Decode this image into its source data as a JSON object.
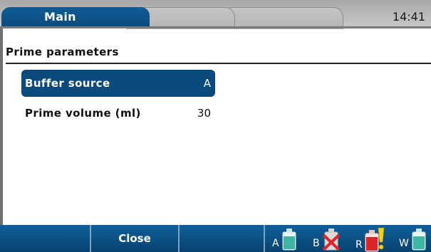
{
  "header": {
    "tabs": [
      {
        "label": "Main",
        "active": true
      },
      {
        "label": "",
        "active": false
      },
      {
        "label": "",
        "active": false
      }
    ],
    "clock": "14:41"
  },
  "section": {
    "title": "Prime parameters"
  },
  "parameters": [
    {
      "name": "Buffer source",
      "value": "A",
      "selected": true
    },
    {
      "name": "Prime volume (ml)",
      "value": "30",
      "selected": false
    }
  ],
  "footer": {
    "buttons": [
      "",
      "Close",
      ""
    ],
    "bottles": [
      {
        "letter": "A",
        "icon": "bottle-teal-icon",
        "status": "ok"
      },
      {
        "letter": "B",
        "icon": "bottle-empty-crossed-icon",
        "status": "not-available"
      },
      {
        "letter": "R",
        "icon": "bottle-red-warning-icon",
        "status": "warning"
      },
      {
        "letter": "W",
        "icon": "bottle-teal-icon",
        "status": "ok"
      }
    ]
  },
  "colors": {
    "accent": "#0a4a7c",
    "top_bar": "#b8b8b8",
    "bottle_teal": "#3fb6a4",
    "bottle_red": "#d8262a",
    "warning_yellow": "#f2d21a",
    "cross_red": "#e0242a"
  }
}
